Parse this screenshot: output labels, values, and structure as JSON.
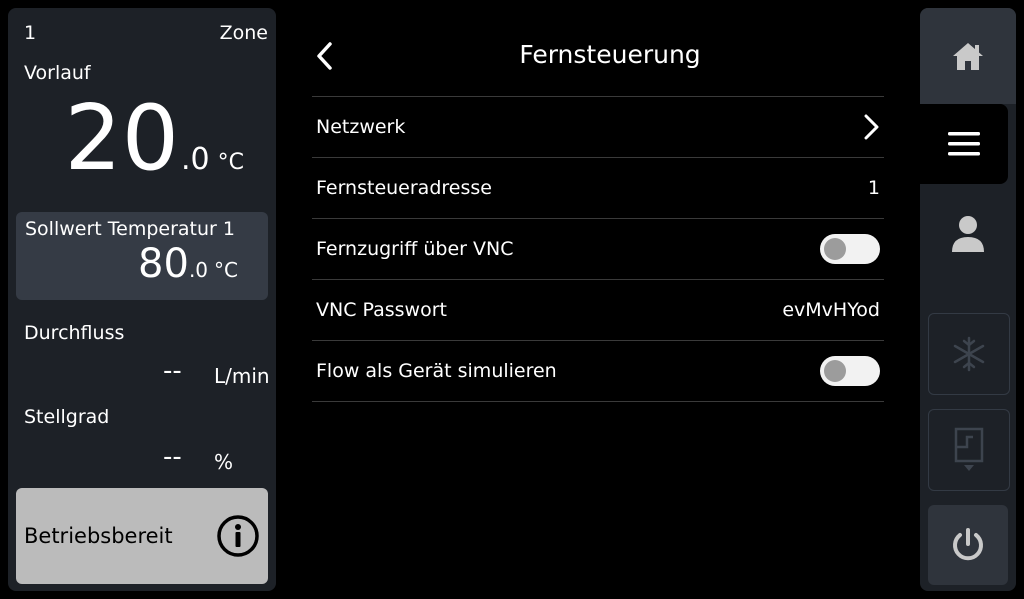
{
  "status_panel": {
    "zone_number": "1",
    "zone_label": "Zone",
    "flow_label": "Vorlauf",
    "flow_temp_int": "20",
    "flow_temp_dec": ".0",
    "temp_unit": "°C",
    "setpoint_label": "Sollwert Temperatur 1",
    "setpoint_int": "80",
    "setpoint_dec": ".0",
    "setpoint_unit": "°C",
    "durchfluss_label": "Durchfluss",
    "durchfluss_value": "--",
    "durchfluss_unit": "L/min",
    "stellgrad_label": "Stellgrad",
    "stellgrad_value": "--",
    "stellgrad_unit": "%",
    "status_text": "Betriebsbereit",
    "status_icon": "info-icon"
  },
  "header": {
    "title": "Fernsteuerung",
    "back_icon": "chevron-left-icon"
  },
  "settings": {
    "rows": [
      {
        "label": "Netzwerk",
        "control": "chevron",
        "icon": "chevron-right-icon"
      },
      {
        "label": "Fernsteueradresse",
        "value": "1"
      },
      {
        "label": "Fernzugriff über VNC",
        "control": "toggle",
        "on": false
      },
      {
        "label": "VNC Passwort",
        "value": "evMvHYod"
      },
      {
        "label": "Flow als Gerät simulieren",
        "control": "toggle",
        "on": false
      }
    ]
  },
  "nav": {
    "items": [
      {
        "icon": "home-icon",
        "active": false
      },
      {
        "icon": "menu-icon",
        "active": true
      },
      {
        "icon": "user-icon",
        "active": false
      },
      {
        "icon": "snowflake-icon",
        "enabled": false
      },
      {
        "icon": "door-icon",
        "enabled": false
      },
      {
        "icon": "power-icon",
        "enabled": true
      }
    ]
  },
  "colors": {
    "background": "#000000",
    "panel": "#1d2127",
    "setpoint_box": "#353b45",
    "status_box": "#bbbbbb",
    "toggle_track": "#f2f2f2",
    "toggle_knob": "#9c9c9c"
  }
}
